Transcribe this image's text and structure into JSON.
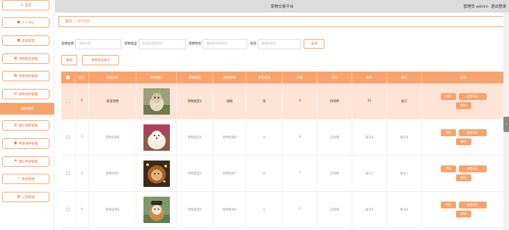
{
  "topbar": {
    "title": "宠物交易平台",
    "user": "管理员 admin",
    "logout": "退出登录"
  },
  "sidebar": {
    "items": [
      {
        "label": "首页",
        "icon": "home-icon"
      },
      {
        "label": "个人中心",
        "icon": "person-icon"
      },
      {
        "label": "卖家管理",
        "icon": "person-icon"
      },
      {
        "label": "宠物类型管理",
        "icon": "grid-icon"
      },
      {
        "label": "宠物领养管理",
        "icon": "grid-icon"
      },
      {
        "label": "宠物领养管理",
        "icon": "document-icon"
      },
      {
        "label": "领养宠物",
        "icon": "",
        "active": true
      },
      {
        "label": "团队领养管理",
        "icon": "document-icon"
      },
      {
        "label": "申请领养管理",
        "icon": "person-icon"
      },
      {
        "label": "团队申请管理",
        "icon": "flag-icon"
      },
      {
        "label": "系统管理",
        "icon": "monitor-icon"
      },
      {
        "label": "订单管理",
        "icon": "grid-icon"
      }
    ]
  },
  "breadcrumb": {
    "home": "首页",
    "sep": "/",
    "current": "领养宠物"
  },
  "filters": {
    "name_label": "宠物名称",
    "name_placeholder": "宠物名称",
    "type_label": "宠物类型",
    "type_placeholder": "请选择宠物类型",
    "gender_label": "宠物性别",
    "gender_placeholder": "请选择宠物性别",
    "status_label": "状态",
    "status_placeholder": "请选择状态",
    "search_label": "查询"
  },
  "actions": {
    "delete_label": "删除",
    "stats_label": "宠物状态统计"
  },
  "table": {
    "headers": [
      "索引",
      "宠物名称",
      "宠物图片",
      "宠物类型",
      "宠物性格",
      "宠物性别",
      "年龄",
      "状态",
      "账号",
      "姓名",
      "操作"
    ],
    "rows": [
      {
        "index": "1",
        "name": "某某宠物",
        "type": "宠物类型2",
        "character": "温顺",
        "gender": "母",
        "age": "3",
        "status": "待领养",
        "account": "11",
        "person": "张三"
      },
      {
        "index": "2",
        "name": "宠物名称8",
        "type": "宠物类型8",
        "character": "宠物性格8",
        "gender": "公",
        "age": "8",
        "status": "已领养",
        "account": "账号8",
        "person": "姓名8"
      },
      {
        "index": "3",
        "name": "宠物名称7",
        "type": "宠物类型7",
        "character": "宠物性格7",
        "gender": "公",
        "age": "7",
        "status": "已领养",
        "account": "账号7",
        "person": "姓名7"
      },
      {
        "index": "4",
        "name": "宠物名称6",
        "type": "宠物类型6",
        "character": "宠物性格6",
        "gender": "公",
        "age": "6",
        "status": "已领养",
        "account": "账号6",
        "person": "姓名6"
      }
    ],
    "op_detail": "详情",
    "op_review": "查看评论",
    "op_delete": "删除"
  },
  "colors": {
    "accent": "#f7a36d",
    "accent_dark": "#e3703c",
    "highlight_row": "#fde4d6",
    "topbar": "#dcdcdc"
  }
}
